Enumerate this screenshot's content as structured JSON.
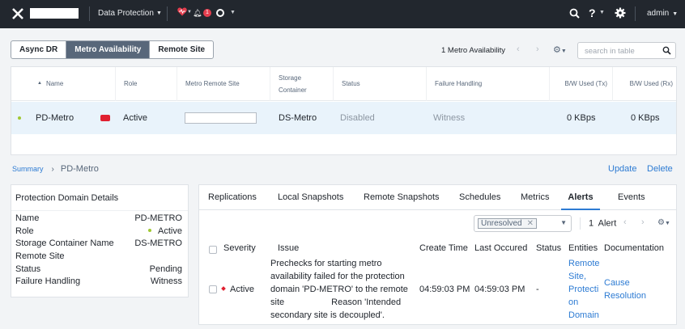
{
  "topbar": {
    "menu_label": "Data Protection",
    "alert_count": "1",
    "user": "admin"
  },
  "toolbar": {
    "segments": [
      "Async DR",
      "Metro Availability",
      "Remote Site"
    ],
    "active_segment": "Metro Availability",
    "count_label": "1 Metro Availability",
    "search_placeholder": "search in table"
  },
  "table": {
    "columns": [
      "Name",
      "Role",
      "Metro Remote Site",
      "Storage Container",
      "Status",
      "Failure Handling",
      "B/W Used (Tx)",
      "B/W Used (Rx)"
    ],
    "rows": [
      {
        "name": "PD-Metro",
        "role": "Active",
        "remote_site": "",
        "storage_container": "DS-Metro",
        "status": "Disabled",
        "failure_handling": "Witness",
        "bw_tx": "0 KBps",
        "bw_rx": "0 KBps"
      }
    ]
  },
  "breadcrumb": {
    "root": "Summary",
    "current": "PD-Metro"
  },
  "actions": {
    "update": "Update",
    "delete": "Delete"
  },
  "details": {
    "title": "Protection Domain Details",
    "fields": [
      {
        "label": "Name",
        "value": "PD-METRO"
      },
      {
        "label": "Role",
        "value": "Active"
      },
      {
        "label": "Storage Container Name",
        "value": "DS-METRO"
      },
      {
        "label": "Remote Site",
        "value": ""
      },
      {
        "label": "Status",
        "value": "Pending"
      },
      {
        "label": "Failure Handling",
        "value": "Witness"
      }
    ]
  },
  "tabs": [
    "Replications",
    "Local Snapshots",
    "Remote Snapshots",
    "Schedules",
    "Metrics",
    "Alerts",
    "Events"
  ],
  "active_tab": "Alerts",
  "alerts": {
    "filter_chip": "Unresolved",
    "count": "1",
    "count_label": "Alert",
    "columns": [
      "Severity",
      "Issue",
      "Create Time",
      "Last Occured",
      "Status",
      "Entities",
      "Documentation"
    ],
    "rows": [
      {
        "severity": "Active",
        "issue_lines": [
          "Prechecks for starting metro",
          "availability failed for the protection",
          "domain 'PD-METRO' to the remote",
          "site                   Reason 'Intended",
          "secondary site is decoupled'."
        ],
        "create_time": "04:59:03 PM",
        "last_occured": "04:59:03 PM",
        "status": "-",
        "entities_lines": [
          "Remote",
          "Site,",
          "Protecti",
          "on",
          "Domain"
        ],
        "documentation_lines": [
          "Cause",
          "Resolution"
        ]
      }
    ]
  },
  "colors": {
    "topbar": "#22272e",
    "accent": "#2d7bd3",
    "active_segment": "#58677a",
    "row_highlight": "#e9f3fb"
  }
}
